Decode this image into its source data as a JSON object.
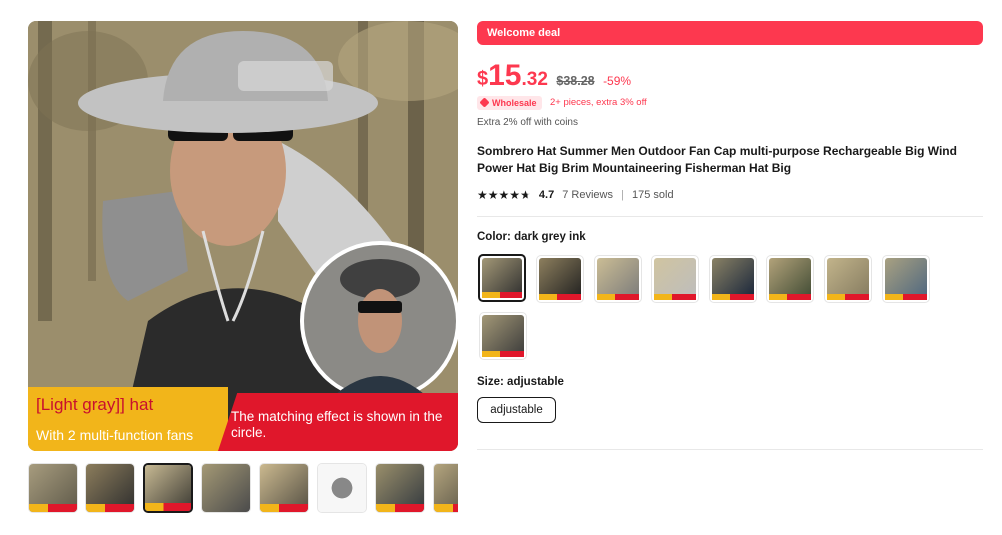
{
  "gallery": {
    "banner_line1": "[Light gray]] hat",
    "banner_line2": "With 2 multi-function fans",
    "banner_note": "The matching effect is shown in the circle.",
    "thumbnails_count": 8,
    "active_thumbnail_index": 2
  },
  "deal": {
    "welcome_label": "Welcome deal"
  },
  "price": {
    "currency": "$",
    "integer": "15",
    "decimal": ".32",
    "original": "$38.28",
    "discount": "-59%"
  },
  "wholesale": {
    "badge": "Wholesale",
    "text": "2+ pieces, extra 3% off"
  },
  "coins_text": "Extra 2% off with coins",
  "product": {
    "title": "Sombrero Hat Summer Men Outdoor Fan Cap multi-purpose Rechargeable Big Wind Power Hat Big Brim Mountaineering Fisherman Hat Big"
  },
  "rating": {
    "value": "4.7",
    "stars": 4.7,
    "reviews": "7 Reviews",
    "separator": "|",
    "sold": "175 sold"
  },
  "color": {
    "label": "Color: ",
    "selected": "dark grey ink",
    "swatch_count": 9,
    "active_index": 0
  },
  "size": {
    "label": "Size: ",
    "selected": "adjustable",
    "options": [
      "adjustable"
    ]
  },
  "colors": {
    "accent": "#fd384f",
    "banner_yellow": "#f2b51a",
    "banner_red": "#e0172b"
  }
}
